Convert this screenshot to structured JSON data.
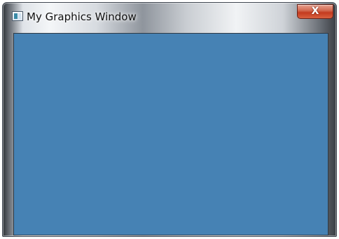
{
  "window": {
    "title": "My Graphics Window",
    "icon": "app-window-icon",
    "close_glyph": "X",
    "canvas_color": "#4682b4"
  }
}
